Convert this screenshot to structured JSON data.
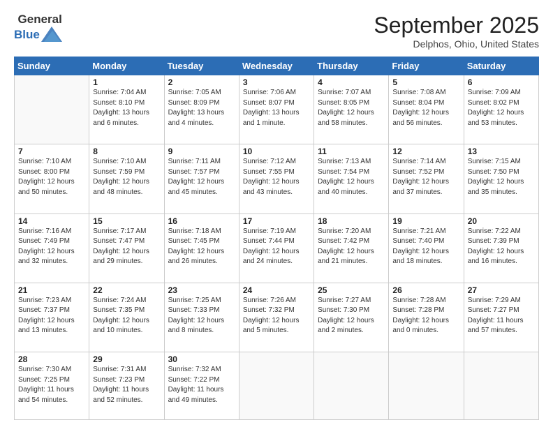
{
  "logo": {
    "general": "General",
    "blue": "Blue"
  },
  "header": {
    "month": "September 2025",
    "location": "Delphos, Ohio, United States"
  },
  "weekdays": [
    "Sunday",
    "Monday",
    "Tuesday",
    "Wednesday",
    "Thursday",
    "Friday",
    "Saturday"
  ],
  "days": [
    {
      "date": "",
      "info": ""
    },
    {
      "date": "1",
      "info": "Sunrise: 7:04 AM\nSunset: 8:10 PM\nDaylight: 13 hours\nand 6 minutes."
    },
    {
      "date": "2",
      "info": "Sunrise: 7:05 AM\nSunset: 8:09 PM\nDaylight: 13 hours\nand 4 minutes."
    },
    {
      "date": "3",
      "info": "Sunrise: 7:06 AM\nSunset: 8:07 PM\nDaylight: 13 hours\nand 1 minute."
    },
    {
      "date": "4",
      "info": "Sunrise: 7:07 AM\nSunset: 8:05 PM\nDaylight: 12 hours\nand 58 minutes."
    },
    {
      "date": "5",
      "info": "Sunrise: 7:08 AM\nSunset: 8:04 PM\nDaylight: 12 hours\nand 56 minutes."
    },
    {
      "date": "6",
      "info": "Sunrise: 7:09 AM\nSunset: 8:02 PM\nDaylight: 12 hours\nand 53 minutes."
    },
    {
      "date": "7",
      "info": "Sunrise: 7:10 AM\nSunset: 8:00 PM\nDaylight: 12 hours\nand 50 minutes."
    },
    {
      "date": "8",
      "info": "Sunrise: 7:10 AM\nSunset: 7:59 PM\nDaylight: 12 hours\nand 48 minutes."
    },
    {
      "date": "9",
      "info": "Sunrise: 7:11 AM\nSunset: 7:57 PM\nDaylight: 12 hours\nand 45 minutes."
    },
    {
      "date": "10",
      "info": "Sunrise: 7:12 AM\nSunset: 7:55 PM\nDaylight: 12 hours\nand 43 minutes."
    },
    {
      "date": "11",
      "info": "Sunrise: 7:13 AM\nSunset: 7:54 PM\nDaylight: 12 hours\nand 40 minutes."
    },
    {
      "date": "12",
      "info": "Sunrise: 7:14 AM\nSunset: 7:52 PM\nDaylight: 12 hours\nand 37 minutes."
    },
    {
      "date": "13",
      "info": "Sunrise: 7:15 AM\nSunset: 7:50 PM\nDaylight: 12 hours\nand 35 minutes."
    },
    {
      "date": "14",
      "info": "Sunrise: 7:16 AM\nSunset: 7:49 PM\nDaylight: 12 hours\nand 32 minutes."
    },
    {
      "date": "15",
      "info": "Sunrise: 7:17 AM\nSunset: 7:47 PM\nDaylight: 12 hours\nand 29 minutes."
    },
    {
      "date": "16",
      "info": "Sunrise: 7:18 AM\nSunset: 7:45 PM\nDaylight: 12 hours\nand 26 minutes."
    },
    {
      "date": "17",
      "info": "Sunrise: 7:19 AM\nSunset: 7:44 PM\nDaylight: 12 hours\nand 24 minutes."
    },
    {
      "date": "18",
      "info": "Sunrise: 7:20 AM\nSunset: 7:42 PM\nDaylight: 12 hours\nand 21 minutes."
    },
    {
      "date": "19",
      "info": "Sunrise: 7:21 AM\nSunset: 7:40 PM\nDaylight: 12 hours\nand 18 minutes."
    },
    {
      "date": "20",
      "info": "Sunrise: 7:22 AM\nSunset: 7:39 PM\nDaylight: 12 hours\nand 16 minutes."
    },
    {
      "date": "21",
      "info": "Sunrise: 7:23 AM\nSunset: 7:37 PM\nDaylight: 12 hours\nand 13 minutes."
    },
    {
      "date": "22",
      "info": "Sunrise: 7:24 AM\nSunset: 7:35 PM\nDaylight: 12 hours\nand 10 minutes."
    },
    {
      "date": "23",
      "info": "Sunrise: 7:25 AM\nSunset: 7:33 PM\nDaylight: 12 hours\nand 8 minutes."
    },
    {
      "date": "24",
      "info": "Sunrise: 7:26 AM\nSunset: 7:32 PM\nDaylight: 12 hours\nand 5 minutes."
    },
    {
      "date": "25",
      "info": "Sunrise: 7:27 AM\nSunset: 7:30 PM\nDaylight: 12 hours\nand 2 minutes."
    },
    {
      "date": "26",
      "info": "Sunrise: 7:28 AM\nSunset: 7:28 PM\nDaylight: 12 hours\nand 0 minutes."
    },
    {
      "date": "27",
      "info": "Sunrise: 7:29 AM\nSunset: 7:27 PM\nDaylight: 11 hours\nand 57 minutes."
    },
    {
      "date": "28",
      "info": "Sunrise: 7:30 AM\nSunset: 7:25 PM\nDaylight: 11 hours\nand 54 minutes."
    },
    {
      "date": "29",
      "info": "Sunrise: 7:31 AM\nSunset: 7:23 PM\nDaylight: 11 hours\nand 52 minutes."
    },
    {
      "date": "30",
      "info": "Sunrise: 7:32 AM\nSunset: 7:22 PM\nDaylight: 11 hours\nand 49 minutes."
    },
    {
      "date": "",
      "info": ""
    },
    {
      "date": "",
      "info": ""
    },
    {
      "date": "",
      "info": ""
    },
    {
      "date": "",
      "info": ""
    }
  ]
}
